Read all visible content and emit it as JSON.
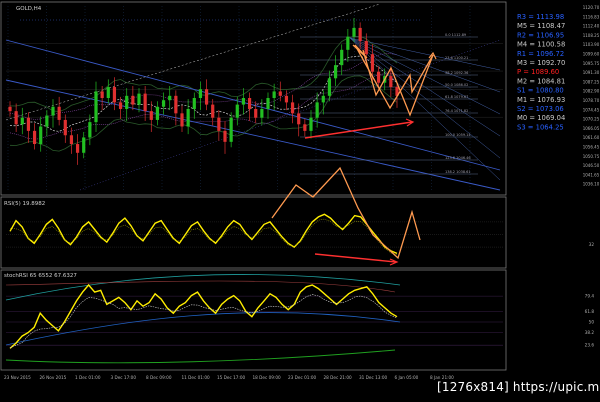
{
  "chart_data": [
    {
      "type": "candlestick",
      "title": "GOLD,H4",
      "x": [
        "23 Nov 2015",
        "26 Nov 2015",
        "1 Dec 01:00",
        "3 Dec 17:00",
        "8 Dec 09:00",
        "11 Dec 01:00",
        "15 Dec 17:00",
        "18 Dec 09:00",
        "23 Dec 01:00",
        "28 Dec 21:00",
        "31 Dec 13:00",
        "6 Jan 05:00",
        "8 Jan 21:00"
      ],
      "ylim": [
        1036.1,
        1121.0
      ],
      "y_ticks": [
        "1120.70",
        "1116.83",
        "1112.40",
        "1108.25",
        "1103.90",
        "1099.60",
        "1095.75",
        "1091.30",
        "1087.25",
        "1082.90",
        "1078.70",
        "1074.45",
        "1070.25",
        "1066.05",
        "1061.60",
        "1056.45",
        "1050.75",
        "1046.50",
        "1041.65",
        "1036.10"
      ],
      "closes": [
        1073,
        1067,
        1070,
        1064,
        1058,
        1066,
        1071,
        1075,
        1069,
        1062,
        1058,
        1054,
        1061,
        1068,
        1082,
        1079,
        1084,
        1077,
        1074,
        1080,
        1076,
        1081,
        1073,
        1069,
        1075,
        1078,
        1080,
        1072,
        1066,
        1074,
        1079,
        1083,
        1076,
        1070,
        1064,
        1059,
        1070,
        1076,
        1079,
        1074,
        1070,
        1074,
        1079,
        1082,
        1080,
        1077,
        1072,
        1067,
        1064,
        1070,
        1077,
        1080,
        1088,
        1094,
        1101,
        1107,
        1111,
        1105,
        1099,
        1091,
        1086,
        1089,
        1084,
        1080
      ],
      "fib_levels": [
        {
          "label": "0.0",
          "value": "1112.89"
        },
        {
          "label": "23.6",
          "value": "1100.21"
        },
        {
          "label": "38.2",
          "value": "1092.36"
        },
        {
          "label": "50.0",
          "value": "1086.02"
        },
        {
          "label": "61.8",
          "value": "1079.67"
        },
        {
          "label": "76.4",
          "value": "1071.82"
        },
        {
          "label": "100.0",
          "value": "1059.14"
        },
        {
          "label": "123.6",
          "value": "1046.46"
        },
        {
          "label": "138.2",
          "value": "1038.61"
        },
        {
          "label": "161.8",
          "value": "1025.93"
        }
      ],
      "pivots": [
        {
          "name": "R3",
          "value": "1113.98",
          "color": "#2860ff"
        },
        {
          "name": "M5",
          "value": "1108.47",
          "color": "#c8c8c8"
        },
        {
          "name": "R2",
          "value": "1106.95",
          "color": "#2860ff"
        },
        {
          "name": "M4",
          "value": "1100.58",
          "color": "#c8c8c8"
        },
        {
          "name": "R1",
          "value": "1096.72",
          "color": "#2860ff"
        },
        {
          "name": "M3",
          "value": "1092.70",
          "color": "#c8c8c8"
        },
        {
          "name": "P",
          "value": "1089.60",
          "color": "#ff2020"
        },
        {
          "name": "M2",
          "value": "1084.81",
          "color": "#c8c8c8"
        },
        {
          "name": "S1",
          "value": "1080.80",
          "color": "#2860ff"
        },
        {
          "name": "M1",
          "value": "1076.93",
          "color": "#c8c8c8"
        },
        {
          "name": "S2",
          "value": "1073.06",
          "color": "#2860ff"
        },
        {
          "name": "M0",
          "value": "1069.04",
          "color": "#c8c8c8"
        },
        {
          "name": "S3",
          "value": "1064.25",
          "color": "#2860ff"
        }
      ]
    },
    {
      "type": "line",
      "title": "RSI(5) 19.8982",
      "ylim": [
        0,
        100
      ],
      "y_ticks": [
        "32"
      ],
      "values": [
        55,
        72,
        62,
        44,
        36,
        50,
        66,
        74,
        60,
        42,
        34,
        46,
        62,
        70,
        58,
        46,
        38,
        52,
        68,
        76,
        64,
        48,
        40,
        54,
        68,
        72,
        58,
        44,
        36,
        50,
        64,
        70,
        56,
        44,
        36,
        48,
        62,
        72,
        66,
        52,
        42,
        54,
        66,
        70,
        58,
        46,
        36,
        30,
        40,
        56,
        70,
        78,
        82,
        76,
        66,
        58,
        68,
        80,
        78,
        66,
        54,
        42,
        30,
        24,
        20
      ]
    },
    {
      "type": "line",
      "title": "stochRSI 65 6552 67.6327",
      "ylim": [
        0,
        100
      ],
      "y_ticks": [
        "79.4",
        "61.8",
        "50",
        "38.2",
        "23.6"
      ],
      "values": [
        20,
        26,
        34,
        38,
        44,
        60,
        52,
        46,
        40,
        50,
        62,
        74,
        84,
        92,
        84,
        86,
        70,
        74,
        78,
        72,
        64,
        74,
        68,
        72,
        82,
        76,
        66,
        60,
        68,
        72,
        80,
        84,
        74,
        66,
        60,
        70,
        76,
        80,
        74,
        62,
        56,
        66,
        74,
        82,
        78,
        70,
        64,
        70,
        84,
        90,
        92,
        88,
        82,
        76,
        70,
        76,
        82,
        86,
        88,
        90,
        82,
        72,
        66,
        60,
        56
      ]
    }
  ],
  "watermark": "[1276x814] https://upic.me/"
}
